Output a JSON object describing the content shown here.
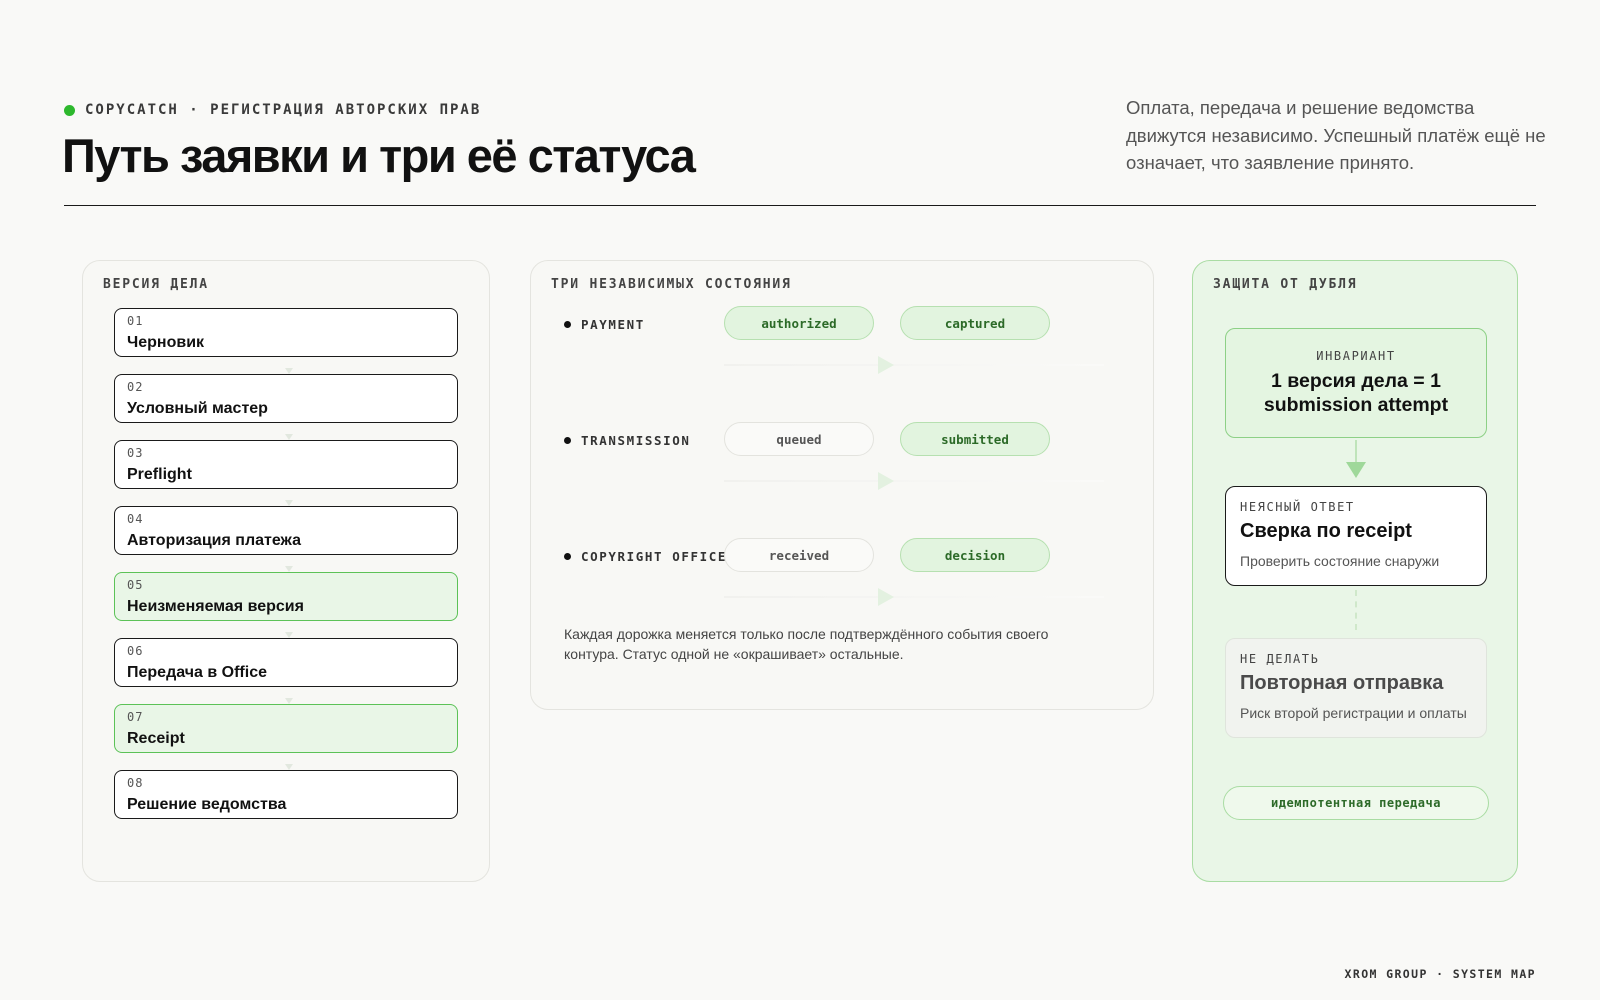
{
  "header": {
    "eyebrow": "COPYCATCH · РЕГИСТРАЦИЯ АВТОРСКИХ ПРАВ",
    "title": "Путь заявки и три её статуса",
    "lede": "Оплата, передача и решение ведомства движутся независимо. Успешный платёж ещё не означает, что заявление принято."
  },
  "left_panel": {
    "label": "ВЕРСИЯ ДЕЛА",
    "steps": [
      {
        "num": "01",
        "name": "Черновик",
        "highlight": false
      },
      {
        "num": "02",
        "name": "Условный мастер",
        "highlight": false
      },
      {
        "num": "03",
        "name": "Preflight",
        "highlight": false
      },
      {
        "num": "04",
        "name": "Авторизация платежа",
        "highlight": false
      },
      {
        "num": "05",
        "name": "Неизменяемая версия",
        "highlight": true
      },
      {
        "num": "06",
        "name": "Передача в Office",
        "highlight": false
      },
      {
        "num": "07",
        "name": "Receipt",
        "highlight": true
      },
      {
        "num": "08",
        "name": "Решение ведомства",
        "highlight": false
      }
    ]
  },
  "middle_panel": {
    "label": "ТРИ НЕЗАВИСИМЫХ СОСТОЯНИЯ",
    "lanes": [
      {
        "name": "PAYMENT",
        "from": "authorized",
        "from_active": true,
        "to": "captured",
        "to_active": true
      },
      {
        "name": "TRANSMISSION",
        "from": "queued",
        "from_active": false,
        "to": "submitted",
        "to_active": true
      },
      {
        "name": "COPYRIGHT OFFICE",
        "from": "received",
        "from_active": false,
        "to": "decision",
        "to_active": true
      }
    ],
    "footnote": "Каждая дорожка меняется только после подтверждённого события своего контура. Статус одной не «окрашивает» остальные."
  },
  "right_panel": {
    "label": "ЗАЩИТА ОТ ДУБЛЯ",
    "invariant": {
      "tag": "ИНВАРИАНТ",
      "text": "1 версия дела = 1 submission attempt"
    },
    "unclear": {
      "tag": "НЕЯСНЫЙ ОТВЕТ",
      "title": "Сверка по receipt",
      "sub": "Проверить состояние снаружи"
    },
    "dont": {
      "tag": "НЕ ДЕЛАТЬ",
      "title": "Повторная отправка",
      "sub": "Риск второй регистрации и оплаты"
    },
    "pill": "идемпотентная передача"
  },
  "colors": {
    "accent_green": "#2db82d",
    "highlight_fill": "#e9f6e7",
    "highlight_border": "#5cc257",
    "pill_text": "#2c6a28"
  },
  "footer": "XROM GROUP · SYSTEM MAP"
}
